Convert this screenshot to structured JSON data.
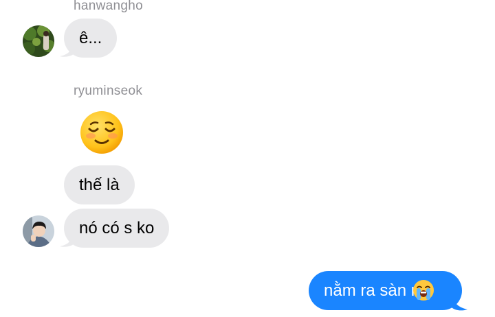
{
  "thread": {
    "groups": [
      {
        "sender": "hanwangho",
        "messages": [
          "ê..."
        ]
      },
      {
        "sender": "ryuminseok",
        "emoji": "smiling-face-with-blush",
        "messages": [
          "thế là",
          "nó có s ko"
        ]
      }
    ],
    "outgoing": {
      "text": "nằm ra sàn r",
      "emoji": "loudly-crying-face"
    }
  },
  "colors": {
    "incoming_bubble": "#e9e9eb",
    "outgoing_bubble": "#1a85ff",
    "sender_name": "#8e8e93"
  }
}
